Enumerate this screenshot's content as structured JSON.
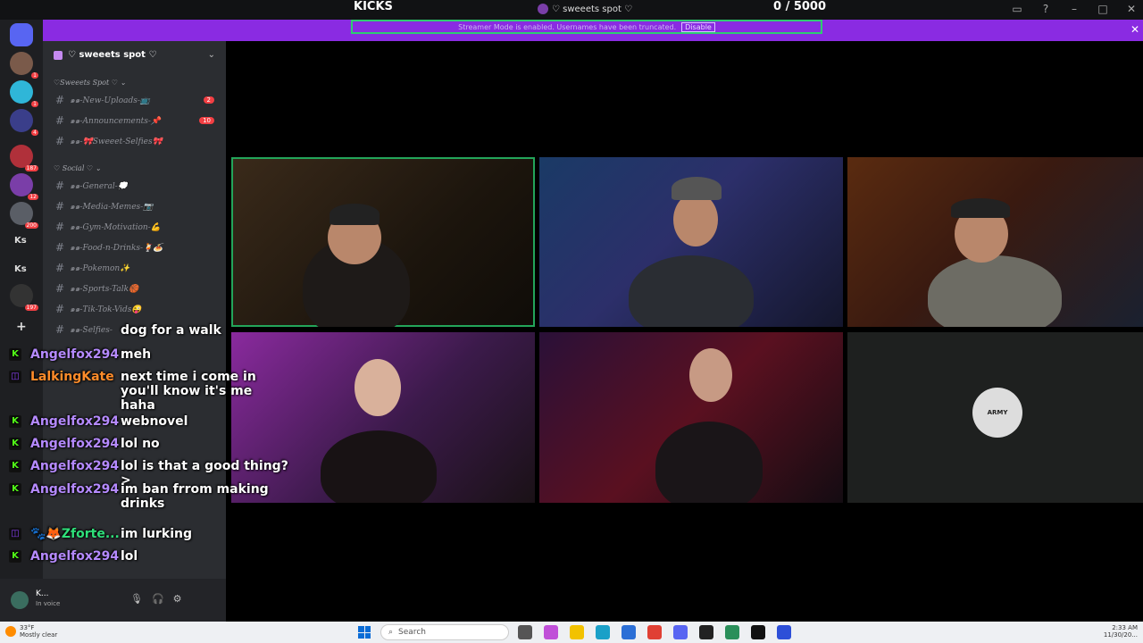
{
  "title_bar": {
    "left_label": "KICKS",
    "server_title": "♡ sweeets spot ♡",
    "counter": "0  / 5000"
  },
  "banner": {
    "text": "Streamer Mode is enabled. Usernames have been truncated.",
    "disable_label": "Disable",
    "color": "#8a2be2"
  },
  "rail": {
    "items": [
      {
        "badge": "1"
      },
      {
        "badge": "1"
      },
      {
        "badge": "4"
      },
      {
        "badge": "187"
      },
      {
        "badge": "12"
      },
      {
        "badge": "200"
      }
    ],
    "text_items": [
      "Ks",
      "Ks"
    ],
    "extra_badge": "197",
    "add_label": "+"
  },
  "sidebar": {
    "server_name": "♡ sweeets spot ♡",
    "categories": [
      {
        "label": "♡Sweeets Spot ♡ ⌄"
      },
      {
        "label": "♡ Social ♡ ⌄"
      }
    ],
    "channels": [
      {
        "label": "๑๑-New-Uploads-📺",
        "badge": "2",
        "unread": true
      },
      {
        "label": "๑๑-Announcements-📌",
        "badge": "10",
        "unread": true
      },
      {
        "label": "๑๑-🎀Sweeet-Selfies🎀",
        "badge": "",
        "unread": false
      },
      {
        "label": "๑๑-General-💭",
        "badge": "",
        "unread": false
      },
      {
        "label": "๑๑-Media-Memes-📷",
        "badge": "",
        "unread": true
      },
      {
        "label": "๑๑-Gym-Motivation-💪",
        "badge": "",
        "unread": false
      },
      {
        "label": "๑๑-Food-n-Drinks-🍹🍝",
        "badge": "",
        "unread": true
      },
      {
        "label": "๑๑-Pokemon✨",
        "badge": "",
        "unread": false
      },
      {
        "label": "๑๑-Sports-Talk🏀",
        "badge": "",
        "unread": true
      },
      {
        "label": "๑๑-Tik-Tok-Vids😜",
        "badge": "",
        "unread": false
      },
      {
        "label": "๑๑-Selfies-",
        "badge": "",
        "unread": false
      }
    ]
  },
  "user_panel": {
    "name": "K...",
    "status": "In voice"
  },
  "tiles": [
    {
      "name": "streamer-1",
      "speaking": true
    },
    {
      "name": "streamer-2",
      "speaking": false
    },
    {
      "name": "streamer-3",
      "speaking": false
    },
    {
      "name": "streamer-4",
      "speaking": false
    },
    {
      "name": "streamer-5",
      "speaking": false
    },
    {
      "name": "streamer-6",
      "logo_text": "ARMY"
    }
  ],
  "chat": [
    {
      "platform": "none",
      "user": "",
      "text": "dog for a walk"
    },
    {
      "platform": "kick",
      "user": "Angelfox294",
      "text": "meh"
    },
    {
      "platform": "twitch",
      "user": "LalkingKate",
      "text": "next time i come in you'll know it's me haha",
      "user_color": "orange"
    },
    {
      "platform": "kick",
      "user": "Angelfox294",
      "text": "webnovel"
    },
    {
      "platform": "kick",
      "user": "Angelfox294",
      "text": "lol no"
    },
    {
      "platform": "kick",
      "user": "Angelfox294",
      "text": "lol is that a good thing?>"
    },
    {
      "platform": "kick",
      "user": "Angelfox294",
      "text": "im ban frrom making drinks"
    },
    {
      "platform": "twitch",
      "user": "🐾🦊Zforte...",
      "text": "im lurking"
    },
    {
      "platform": "kick",
      "user": "Angelfox294",
      "text": "lol"
    }
  ],
  "taskbar": {
    "weather_temp": "33°F",
    "weather_desc": "Mostly clear",
    "search_placeholder": "Search",
    "time": "2:33 AM",
    "date": "11/30/20..."
  }
}
